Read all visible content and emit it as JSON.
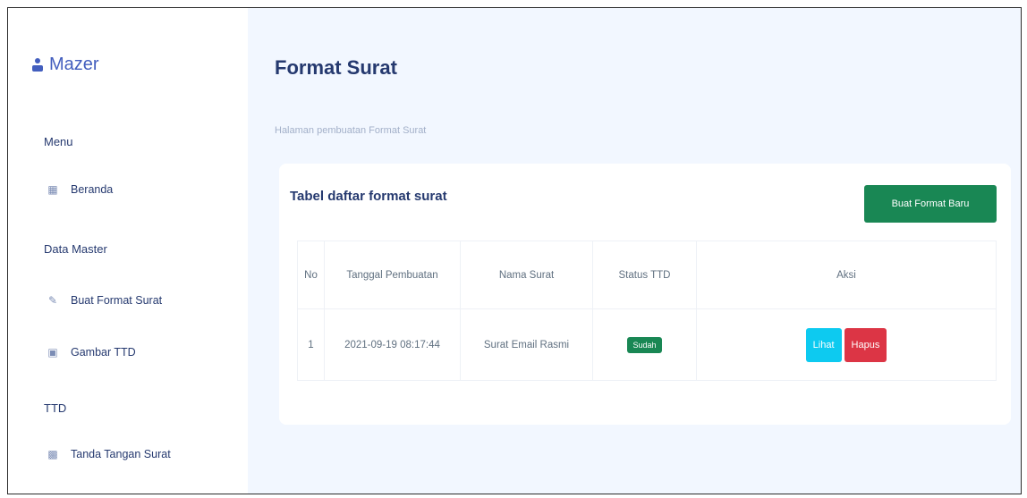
{
  "brand": {
    "name": "Mazer",
    "icon": "user-icon"
  },
  "sidebar": {
    "sections": [
      {
        "title": "Menu",
        "items": [
          {
            "label": "Beranda",
            "icon": "grid-icon"
          }
        ]
      },
      {
        "title": "Data Master",
        "items": [
          {
            "label": "Buat Format Surat",
            "icon": "edit-icon"
          },
          {
            "label": "Gambar TTD",
            "icon": "image-icon"
          }
        ]
      },
      {
        "title": "TTD",
        "items": [
          {
            "label": "Tanda Tangan Surat",
            "icon": "file-icon"
          }
        ]
      }
    ]
  },
  "page": {
    "title": "Format Surat",
    "subtitle": "Halaman pembuatan Format Surat"
  },
  "card": {
    "title": "Tabel daftar format surat",
    "new_button": "Buat Format Baru"
  },
  "table": {
    "headers": [
      "No",
      "Tanggal Pembuatan",
      "Nama Surat",
      "Status TTD",
      "Aksi"
    ],
    "rows": [
      {
        "no": "1",
        "tanggal": "2021-09-19 08:17:44",
        "nama": "Surat Email Rasmi",
        "status": "Sudah",
        "actions": {
          "view": "Lihat",
          "delete": "Hapus"
        }
      }
    ]
  },
  "colors": {
    "background": "#f2f7ff",
    "primary": "#435ebe",
    "success": "#198754",
    "info": "#0dcaf0",
    "danger": "#dc3545"
  }
}
